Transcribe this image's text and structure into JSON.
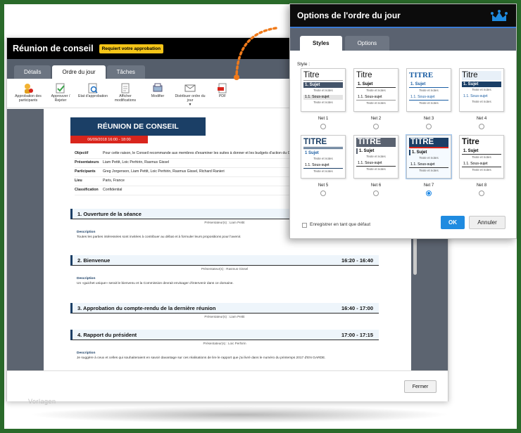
{
  "main": {
    "title": "Réunion de conseil",
    "approval_badge": "Requiert votre approbation",
    "tabs": [
      {
        "label": "Détails"
      },
      {
        "label": "Ordre du jour"
      },
      {
        "label": "Tâches"
      }
    ],
    "toolbar": [
      {
        "label": "Approbation des participants",
        "icon": "user-icon"
      },
      {
        "label": "Approuver / Rejeter",
        "icon": "approve-icon"
      },
      {
        "label": "Etat d'approbation",
        "icon": "status-icon"
      },
      {
        "label": "Afficher modifications",
        "icon": "document-icon"
      },
      {
        "label": "Modifier",
        "icon": "edit-icon"
      },
      {
        "label": "Distribuer ordre du jour",
        "icon": "mail-icon"
      },
      {
        "label": "PDF",
        "icon": "pdf-icon"
      }
    ],
    "close_label": "Fermer"
  },
  "document": {
    "banner": "RÉUNION DE CONSEIL",
    "date": "06/09/2018 16:00 - 18:00",
    "meta": [
      {
        "key": "Objectif",
        "value": "Pour cette raison, le Conseil recommande aux membres d'examiner les suites à donner et les budgets d'action du Conseil."
      },
      {
        "key": "Présentateurs",
        "value": "Liam Pettit, Loic Perhirin, Rasmus Gissel"
      },
      {
        "key": "Participants",
        "value": "Greg Jorgenson, Liam Pettit, Loic Perhirin, Rasmus Gissel, Richard Ranieri"
      },
      {
        "key": "Lieu",
        "value": "Paris, France"
      },
      {
        "key": "Classification",
        "value": "Confidential"
      }
    ],
    "items": [
      {
        "title": "1. Ouverture de la séance",
        "time": "",
        "presenter": "Présentateur(s) : Liam Pettit",
        "desc_label": "Description",
        "desc": "Toutes les parties intéressées sont invitées à contribuer au débat et à formuler leurs propositions pour l'avenir."
      },
      {
        "title": "2. Bienvenue",
        "time": "16:20 - 16:40",
        "presenter": "Présentateur(s) : Rasmus Gissel",
        "desc_label": "Description",
        "desc": "Un «guichet unique» serait le bienvenu et la Commission devrait envisager d'intervenir dans ce domaine."
      },
      {
        "title": "3. Approbation du compte-rendu de la dernière réunion",
        "time": "16:40 - 17:00",
        "presenter": "Présentateur(s) : Liam Pettit",
        "desc_label": "",
        "desc": ""
      },
      {
        "title": "4. Rapport du président",
        "time": "17:00 - 17:15",
        "presenter": "Présentateur(s) : Loic Perhirin",
        "desc_label": "Description",
        "desc": "Je suggère à ceux et celles qui souhaiteraient en savoir davantage sur ces réalisations de lire le rapport que j'ai livré dans le numéro du printemps 2017 d'EN GARDE."
      }
    ]
  },
  "dialog": {
    "title": "Options de l'ordre du jour",
    "tabs": [
      {
        "label": "Styles"
      },
      {
        "label": "Options"
      }
    ],
    "style_label": "Style :",
    "styles": [
      {
        "name": "Net 1",
        "title": "Titre",
        "subject": "1. Sujet",
        "notes": "Texte et notes",
        "subsubject": "1.1. Sous-sujet",
        "notes2": "Texte et notes"
      },
      {
        "name": "Net 2",
        "title": "Titre",
        "subject": "1. Sujet",
        "notes": "Texte et notes",
        "subsubject": "1.1. Sous-sujet",
        "notes2": "Texte et notes"
      },
      {
        "name": "Net 3",
        "title": "TITRE",
        "subject": "1. Sujet",
        "notes": "Texte et notes",
        "subsubject": "1.1. Sous-sujet",
        "notes2": "Texte et notes"
      },
      {
        "name": "Net 4",
        "title": "Titre",
        "subject": "1. Sujet",
        "notes": "Texte et notes",
        "subsubject": "1.1. Sous-sujet",
        "notes2": "Texte et notes"
      },
      {
        "name": "Net 5",
        "title": "TITRE",
        "subject": "1 Sujet",
        "notes": "Texte et notes",
        "subsubject": "1.1. Sous-sujet",
        "notes2": "Texte et notes"
      },
      {
        "name": "Net 6",
        "title": "TITRE",
        "subject": "1. Sujet",
        "notes": "Texte et notes",
        "subsubject": "1.1. Sous-sujet",
        "notes2": "Texte et notes"
      },
      {
        "name": "Net 7",
        "title": "TITRE",
        "subject": "1. Sujet",
        "notes": "Texte et notes",
        "subsubject": "1.1. Sous-sujet",
        "notes2": "Texte et notes"
      },
      {
        "name": "Net 8",
        "title": "Titre",
        "subject": "1. Sujet",
        "notes": "Texte et notes",
        "subsubject": "1.1. Sous-sujet",
        "notes2": "Texte et notes"
      }
    ],
    "selected_style": "Net 7",
    "default_label": "Enregistrer en tant que défaut",
    "ok_label": "OK",
    "cancel_label": "Annuler"
  },
  "watermark": "Vorlagen",
  "colors": {
    "frame": "#2a6a2a",
    "accent": "#1f8be0",
    "navy": "#1b3f66",
    "badge": "#f5c518",
    "date_bar": "#d9251c",
    "connector": "#f07a1a"
  }
}
